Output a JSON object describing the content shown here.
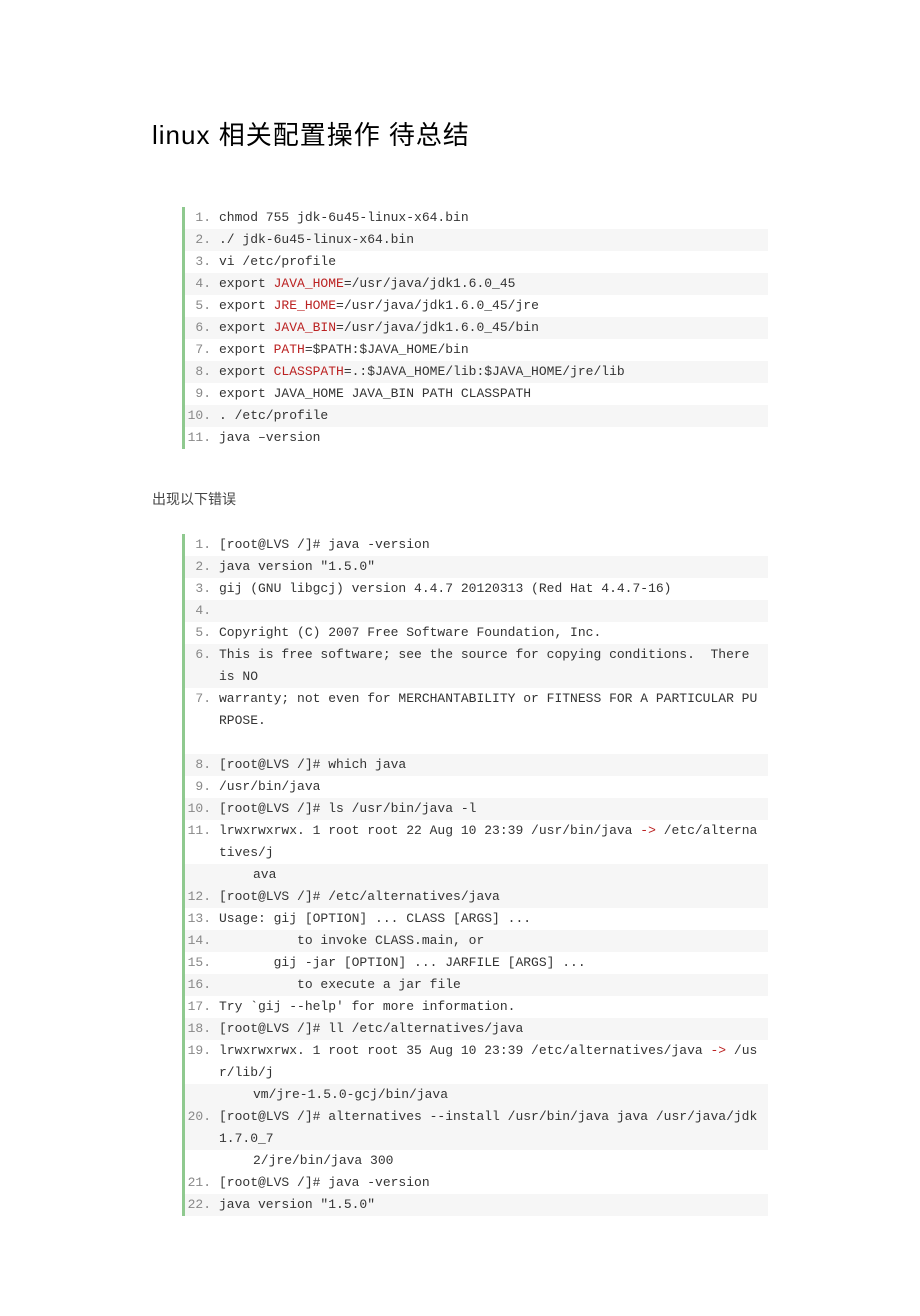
{
  "title": "linux 相关配置操作 待总结",
  "section_error": "出现以下错误",
  "block1": [
    {
      "n": "1.",
      "segs": [
        {
          "t": "chmod 755 jdk-6u45-linux-x64.bin"
        }
      ]
    },
    {
      "n": "2.",
      "segs": [
        {
          "t": "./ jdk-6u45-linux-x64.bin"
        }
      ]
    },
    {
      "n": "3.",
      "segs": [
        {
          "t": "vi /etc/profile"
        }
      ]
    },
    {
      "n": "4.",
      "segs": [
        {
          "t": "export "
        },
        {
          "t": "JAVA_HOME",
          "c": "red"
        },
        {
          "t": "=/usr/java/jdk1.6.0_45"
        }
      ]
    },
    {
      "n": "5.",
      "segs": [
        {
          "t": "export "
        },
        {
          "t": "JRE_HOME",
          "c": "red"
        },
        {
          "t": "=/usr/java/jdk1.6.0_45/jre"
        }
      ]
    },
    {
      "n": "6.",
      "segs": [
        {
          "t": "export "
        },
        {
          "t": "JAVA_BIN",
          "c": "red"
        },
        {
          "t": "=/usr/java/jdk1.6.0_45/bin"
        }
      ]
    },
    {
      "n": "7.",
      "segs": [
        {
          "t": "export "
        },
        {
          "t": "PATH",
          "c": "red"
        },
        {
          "t": "=$PATH:$JAVA_HOME/bin"
        }
      ]
    },
    {
      "n": "8.",
      "segs": [
        {
          "t": "export "
        },
        {
          "t": "CLASSPATH",
          "c": "red"
        },
        {
          "t": "=.:$JAVA_HOME/lib:$JAVA_HOME/jre/lib"
        }
      ]
    },
    {
      "n": "9.",
      "segs": [
        {
          "t": "export JAVA_HOME JAVA_BIN PATH CLASSPATH"
        }
      ]
    },
    {
      "n": "10.",
      "segs": [
        {
          "t": ". /etc/profile"
        }
      ]
    },
    {
      "n": "11.",
      "segs": [
        {
          "t": "java –version"
        }
      ]
    }
  ],
  "block2": [
    {
      "n": "1.",
      "segs": [
        {
          "t": "[root@LVS /]# java -version"
        }
      ]
    },
    {
      "n": "2.",
      "segs": [
        {
          "t": "java version \"1.5.0\""
        }
      ]
    },
    {
      "n": "3.",
      "segs": [
        {
          "t": "gij (GNU libgcj) version 4.4.7 20120313 (Red Hat 4.4.7-16)"
        }
      ]
    },
    {
      "n": "4.",
      "segs": [
        {
          "t": "  "
        }
      ]
    },
    {
      "n": "5.",
      "segs": [
        {
          "t": "Copyright (C) 2007 Free Software Foundation, Inc."
        }
      ]
    },
    {
      "n": "6.",
      "segs": [
        {
          "t": "This is free software; see the source for copying conditions.  There is NO"
        }
      ]
    },
    {
      "n": "7.",
      "segs": [
        {
          "t": "warranty; not even for MERCHANTABILITY or FITNESS FOR A PARTICULAR PURPOSE."
        }
      ]
    },
    {
      "n": "",
      "segs": [
        {
          "t": ""
        }
      ],
      "blank": true
    },
    {
      "n": "8.",
      "segs": [
        {
          "t": "[root@LVS /]# which java"
        }
      ]
    },
    {
      "n": "9.",
      "segs": [
        {
          "t": "/usr/bin/java"
        }
      ]
    },
    {
      "n": "10.",
      "segs": [
        {
          "t": "[root@LVS /]# ls /usr/bin/java -l"
        }
      ]
    },
    {
      "n": "11.",
      "segs": [
        {
          "t": "lrwxrwxrwx. 1 root root 22 Aug 10 23:39 /usr/bin/java "
        },
        {
          "t": "->",
          "c": "red"
        },
        {
          "t": " /etc/alternatives/j"
        }
      ]
    },
    {
      "n": "",
      "segs": [
        {
          "t": "ava"
        }
      ],
      "cont": true
    },
    {
      "n": "12.",
      "segs": [
        {
          "t": "[root@LVS /]# /etc/alternatives/java"
        }
      ]
    },
    {
      "n": "13.",
      "segs": [
        {
          "t": "Usage: gij [OPTION] ... CLASS [ARGS] ..."
        }
      ]
    },
    {
      "n": "14.",
      "segs": [
        {
          "t": "          to invoke CLASS.main, or"
        }
      ]
    },
    {
      "n": "15.",
      "segs": [
        {
          "t": "       gij -jar [OPTION] ... JARFILE [ARGS] ..."
        }
      ]
    },
    {
      "n": "16.",
      "segs": [
        {
          "t": "          to execute a jar file"
        }
      ]
    },
    {
      "n": "17.",
      "segs": [
        {
          "t": "Try `gij --help' for more information."
        }
      ]
    },
    {
      "n": "18.",
      "segs": [
        {
          "t": "[root@LVS /]# ll /etc/alternatives/java"
        }
      ]
    },
    {
      "n": "19.",
      "segs": [
        {
          "t": "lrwxrwxrwx. 1 root root 35 Aug 10 23:39 /etc/alternatives/java "
        },
        {
          "t": "->",
          "c": "red"
        },
        {
          "t": " /usr/lib/j"
        }
      ]
    },
    {
      "n": "",
      "segs": [
        {
          "t": "vm/jre-1.5.0-gcj/bin/java"
        }
      ],
      "cont": true
    },
    {
      "n": "20.",
      "segs": [
        {
          "t": "[root@LVS /]# alternatives --install /usr/bin/java java /usr/java/jdk1.7.0_7"
        }
      ]
    },
    {
      "n": "",
      "segs": [
        {
          "t": "2/jre/bin/java 300"
        }
      ],
      "cont": true
    },
    {
      "n": "21.",
      "segs": [
        {
          "t": "[root@LVS /]# java -version"
        }
      ]
    },
    {
      "n": "22.",
      "segs": [
        {
          "t": "java version \"1.5.0\""
        }
      ]
    }
  ]
}
